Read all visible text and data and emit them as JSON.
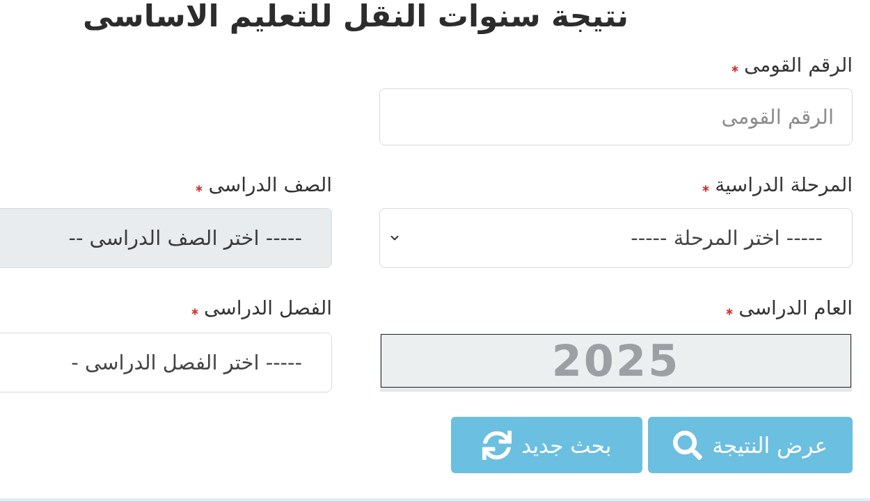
{
  "title": "نتيجة سنوات النقل للتعليم الاساسى",
  "rows": [
    [
      {
        "kind": "text",
        "label": "الرقم القومى",
        "required": true,
        "placeholder": "الرقم القومى"
      }
    ],
    [
      {
        "kind": "select",
        "label": "المرحلة الدراسية",
        "required": true,
        "value": "----- اختر المرحلة -----",
        "disabled": false
      },
      {
        "kind": "select",
        "label": "الصف الدراسى",
        "required": true,
        "value": "----- اختر الصف الدراسى --",
        "disabled": true
      }
    ],
    [
      {
        "kind": "year",
        "label": "العام الدراسى",
        "required": true,
        "value": "2025"
      },
      {
        "kind": "select",
        "label": "الفصل الدراسى",
        "required": true,
        "value": "----- اختر الفصل الدراسى -",
        "disabled": false
      }
    ]
  ],
  "buttons": [
    {
      "kind": "submit",
      "label": "عرض النتيجة"
    },
    {
      "kind": "reset",
      "label": "بحث جديد"
    }
  ]
}
